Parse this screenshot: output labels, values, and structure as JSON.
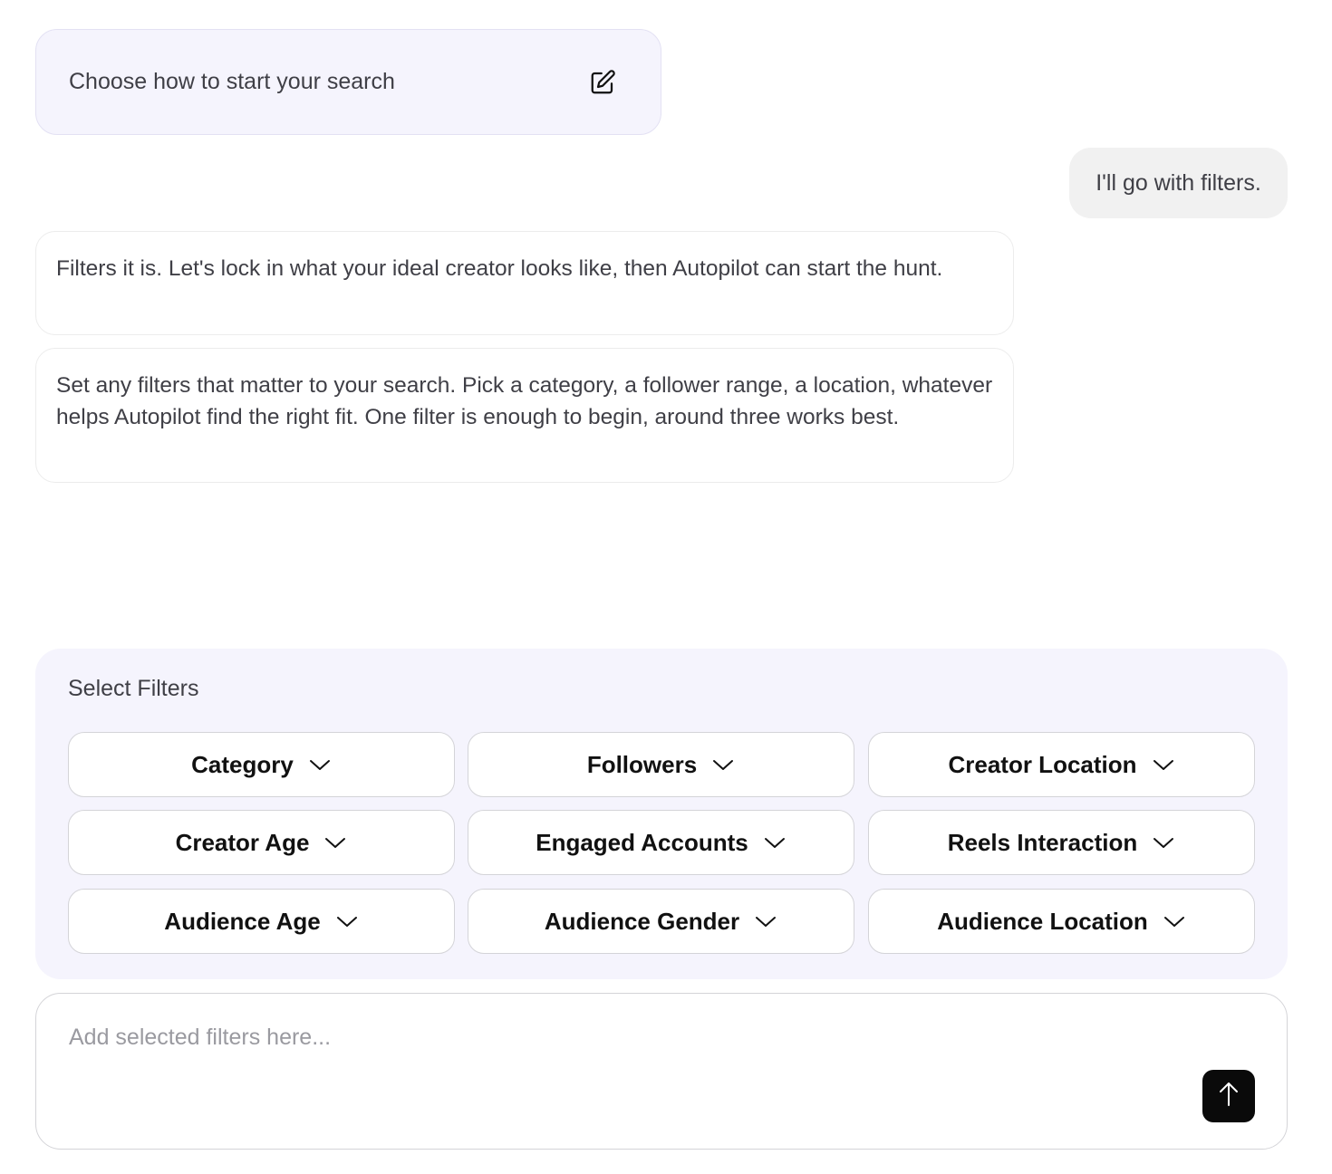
{
  "start_card": {
    "title": "Choose how to start your search",
    "icon": "edit-icon"
  },
  "chat": {
    "user_message": "I'll go with filters.",
    "bot_messages": [
      "Filters it is. Let's lock in what your ideal creator looks like, then Autopilot can start the hunt.",
      "Set any filters that matter to your search. Pick a category, a follower range, a location, whatever helps Autopilot find the right fit. One filter is enough to begin, around three works best."
    ]
  },
  "filters": {
    "title": "Select Filters",
    "items": [
      "Category",
      "Followers",
      "Creator Location",
      "Creator Age",
      "Engaged Accounts",
      "Reels Interaction",
      "Audience Age",
      "Audience Gender",
      "Audience Location"
    ],
    "chevron_icon": "chevron-down-icon"
  },
  "composer": {
    "placeholder": "Add selected filters here...",
    "value": "",
    "send_icon": "arrow-up-icon"
  },
  "colors": {
    "panel_bg": "#f5f4fd",
    "user_bubble_bg": "#f1f1f1",
    "send_button_bg": "#0a0a0a",
    "text": "#3f3f46"
  }
}
